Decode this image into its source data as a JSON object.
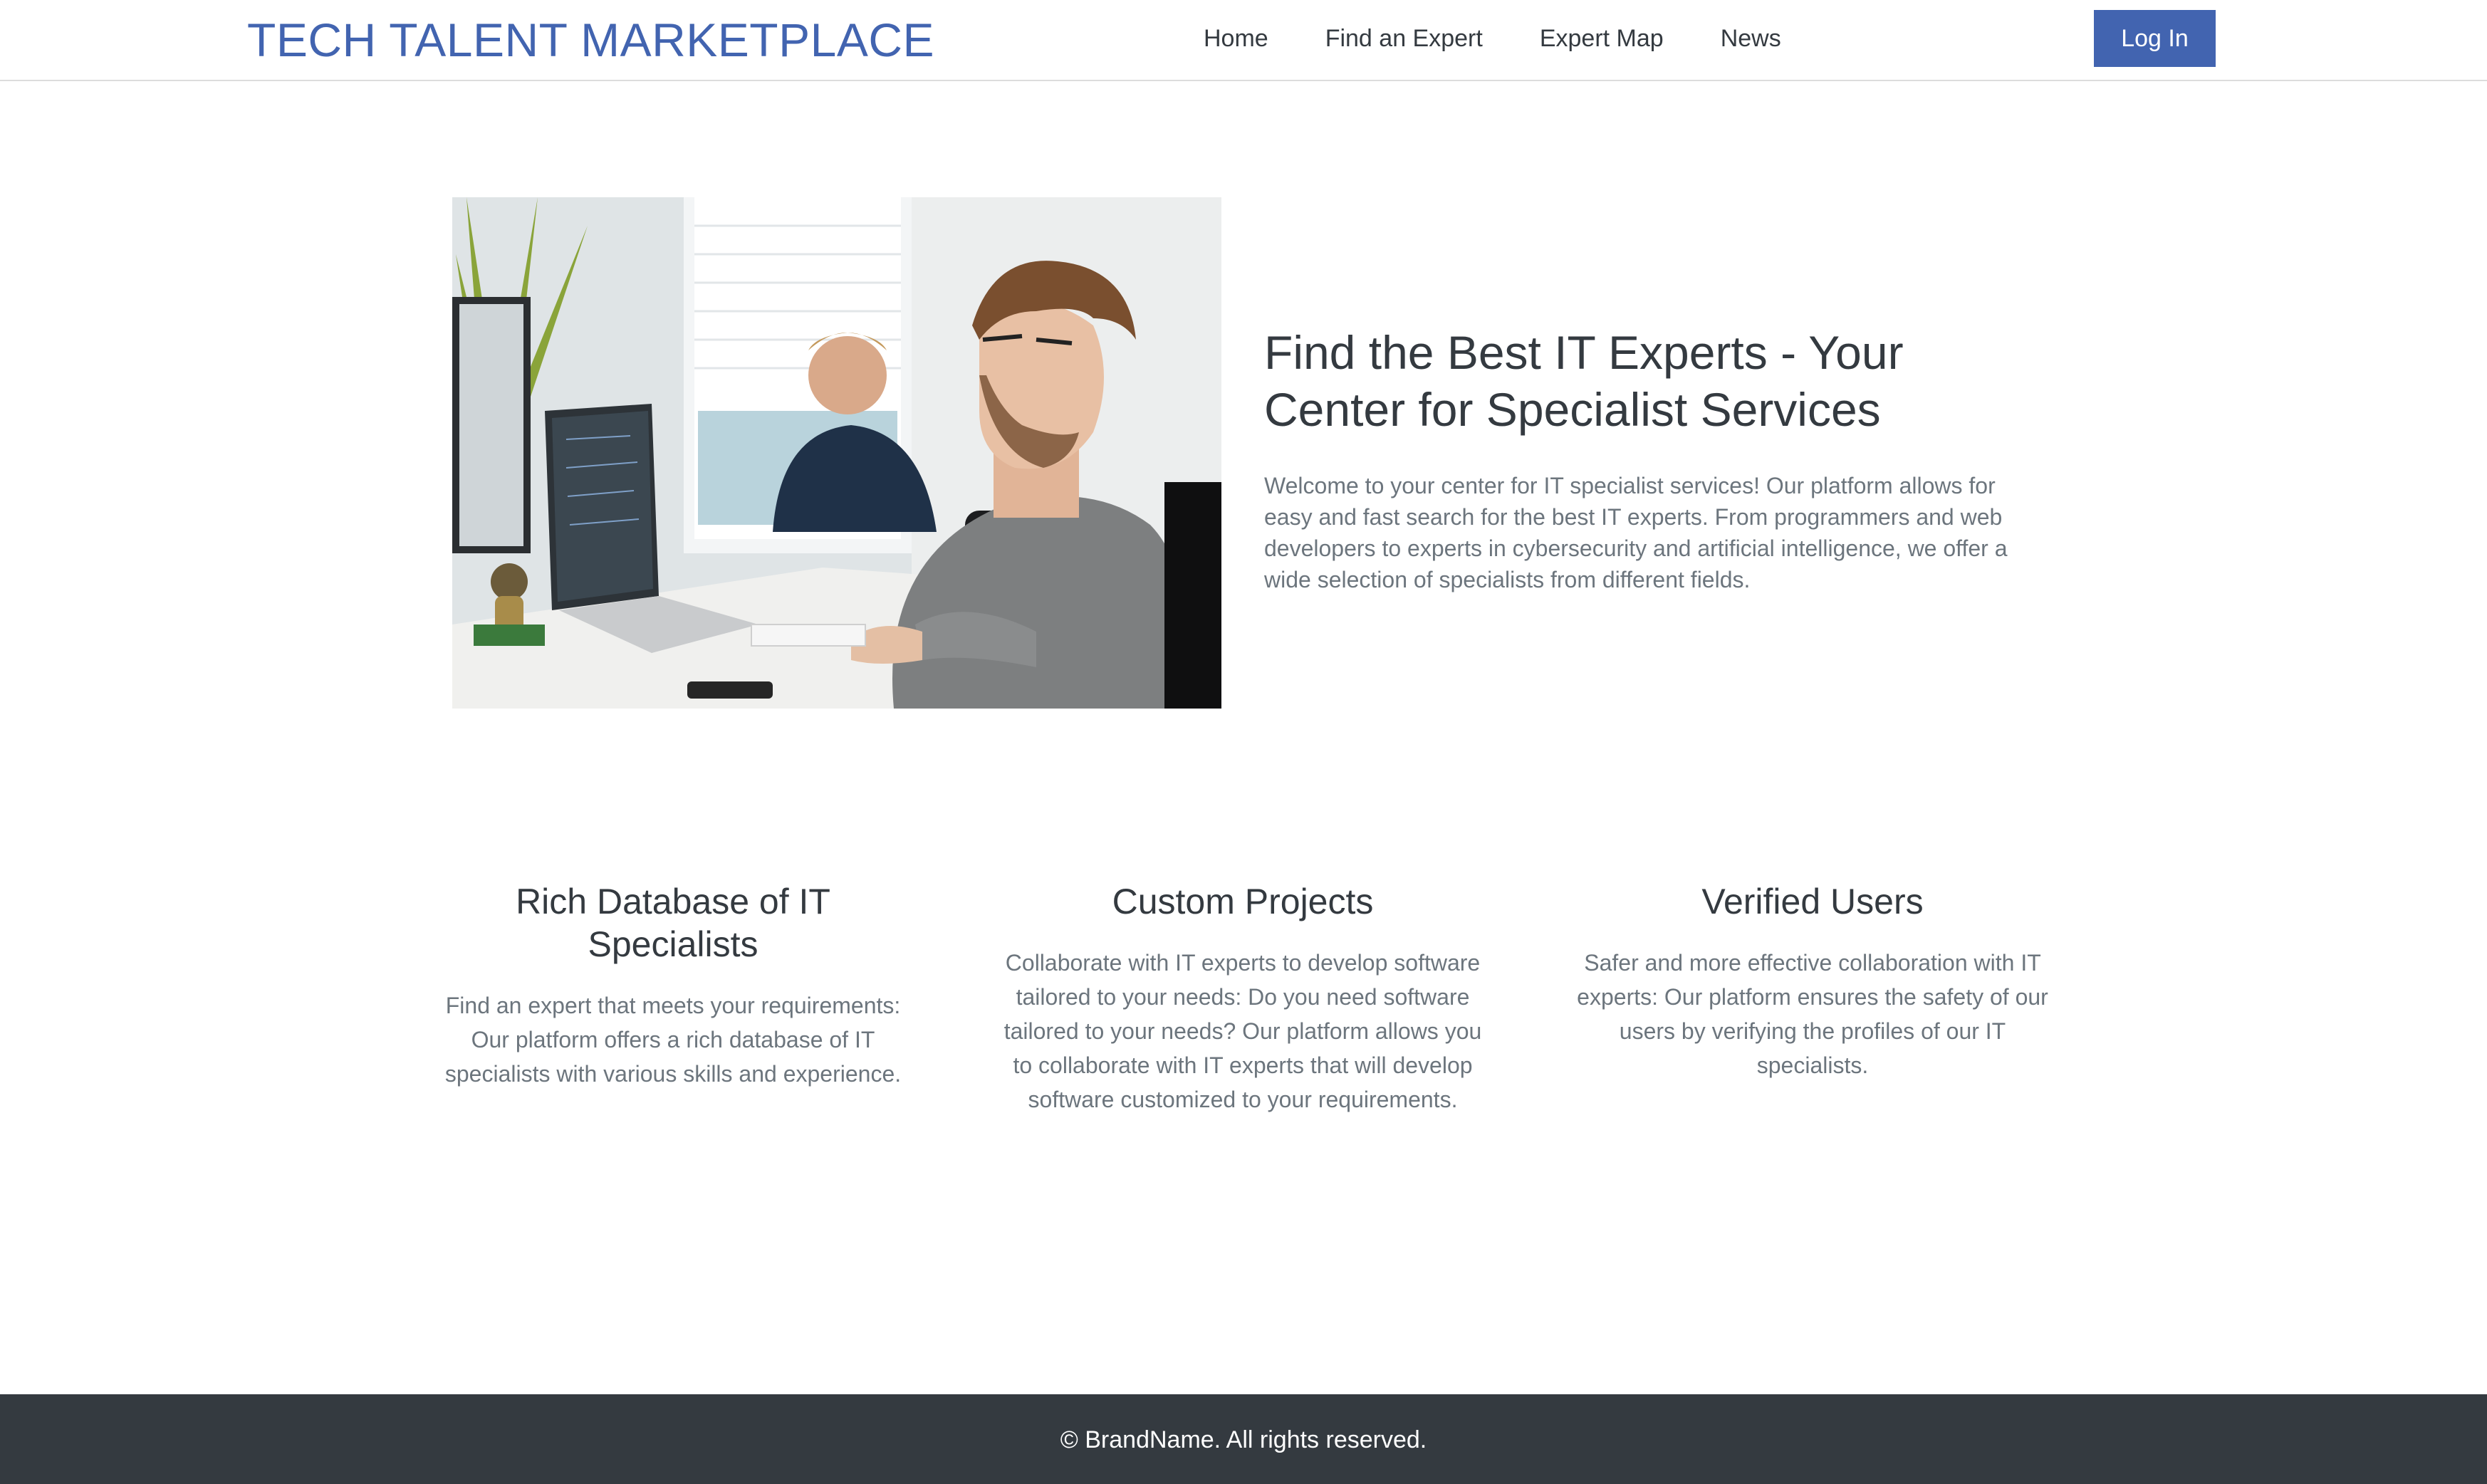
{
  "navbar": {
    "brand": "TECH TALENT MARKETPLACE",
    "links": [
      "Home",
      "Find an Expert",
      "Expert Map",
      "News"
    ],
    "login_label": "Log In",
    "accent_color": "#4264b0"
  },
  "hero": {
    "image_description_icon": "office-photo",
    "title": "Find the Best IT Experts - Your Center for Specialist Services",
    "text": "Welcome to your center for IT specialist services! Our platform allows for easy and fast search for the best IT experts. From programmers and web developers to experts in cybersecurity and artificial intelligence, we offer a wide selection of specialists from different fields."
  },
  "features": [
    {
      "title": "Rich Database of IT Specialists",
      "text": "Find an expert that meets your requirements: Our platform offers a rich database of IT specialists with various skills and experience."
    },
    {
      "title": "Custom Projects",
      "text": "Collaborate with IT experts to develop software tailored to your needs: Do you need software tailored to your needs? Our platform allows you to collaborate with IT experts that will develop software customized to your requirements."
    },
    {
      "title": "Verified Users",
      "text": "Safer and more effective collaboration with IT experts: Our platform ensures the safety of our users by verifying the profiles of our IT specialists."
    }
  ],
  "footer": {
    "text": "© BrandName. All rights reserved.",
    "background_color": "#343a40"
  }
}
